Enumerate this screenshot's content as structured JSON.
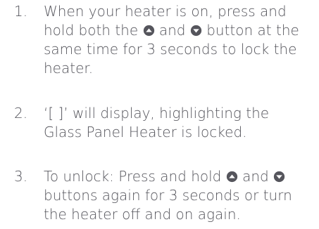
{
  "steps": [
    {
      "number": "1.",
      "lines": [
        {
          "before": "When your heater is on, press and"
        },
        {
          "before": "hold both the ",
          "icon1": "up-arrow-circle-icon",
          "middle": " and ",
          "icon2": "down-arrow-circle-icon",
          "after": " button at the"
        },
        {
          "before": "same time for 3 seconds to lock the"
        },
        {
          "before": "heater."
        }
      ]
    },
    {
      "number": "2.",
      "lines": [
        {
          "before": "‘[ ]’ will display, highlighting the"
        },
        {
          "before": "Glass Panel Heater is locked."
        }
      ]
    },
    {
      "number": "3.",
      "lines": [
        {
          "before": "To unlock: Press and hold ",
          "icon1": "up-arrow-circle-icon",
          "middle": " and ",
          "icon2": "down-arrow-circle-icon"
        },
        {
          "before": "buttons again for 3 seconds or turn"
        },
        {
          "before": "the heater off and on again."
        }
      ]
    }
  ],
  "colors": {
    "text": "#55555c",
    "icon_fill": "#55555c",
    "icon_arrow": "#ffffff"
  }
}
